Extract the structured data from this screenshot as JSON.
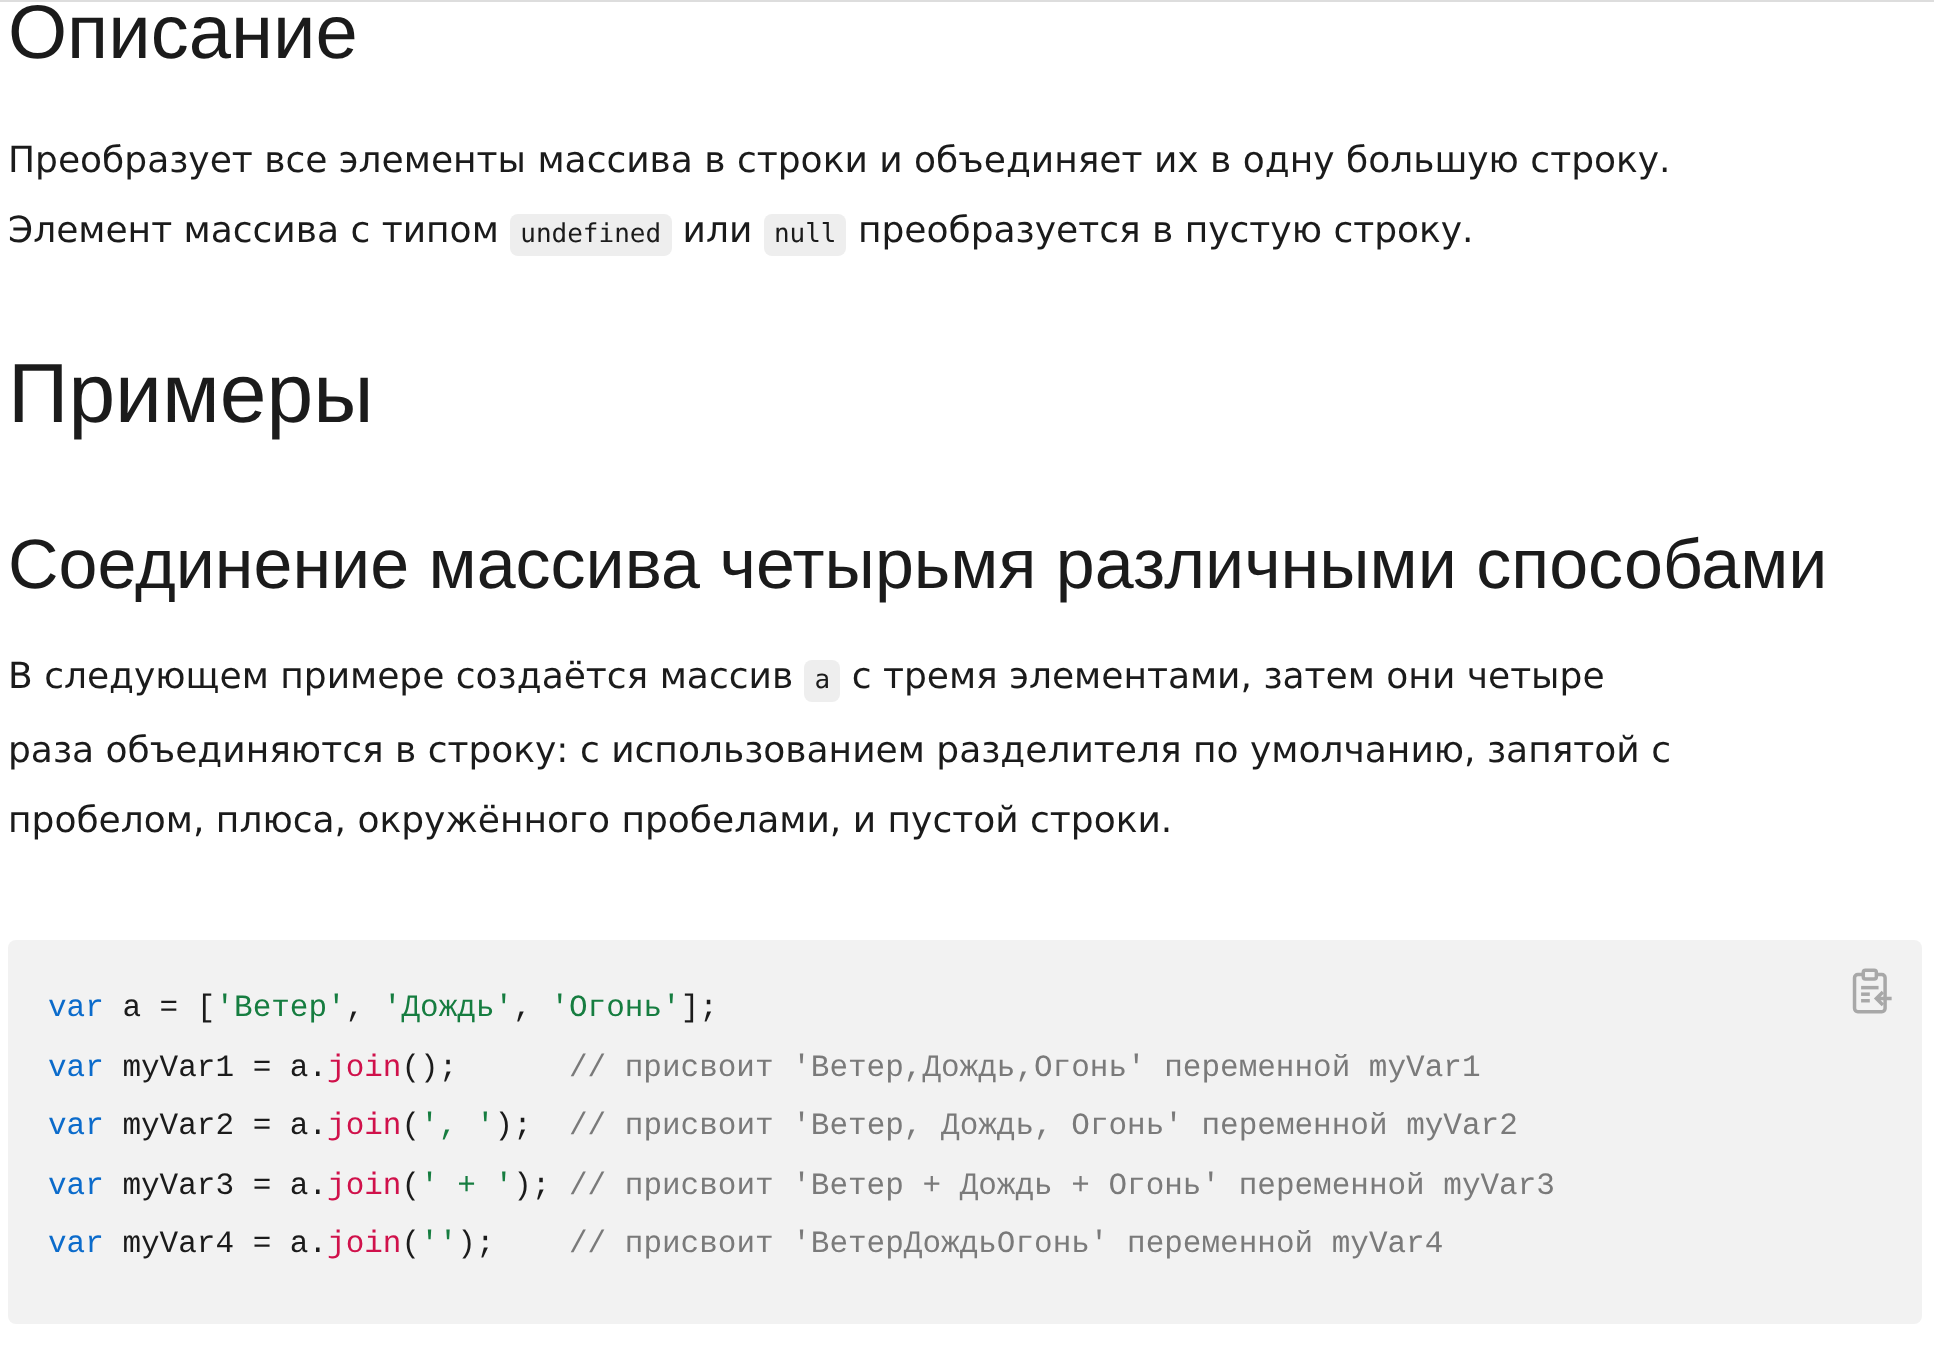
{
  "sections": [
    {
      "kind": "h2",
      "text": "Описание"
    },
    {
      "kind": "paragraph",
      "parts": [
        {
          "kind": "text",
          "text": "Преобразует все элементы массива в строки и объединяет их в одну большую строку. Элемент массива с типом "
        },
        {
          "kind": "code",
          "text": "undefined"
        },
        {
          "kind": "text",
          "text": " или "
        },
        {
          "kind": "code",
          "text": "null"
        },
        {
          "kind": "text",
          "text": " преобразуется в пустую строку."
        }
      ]
    },
    {
      "kind": "h2",
      "text": "Примеры"
    },
    {
      "kind": "h3",
      "text": "Соединение массива четырьмя различными способами"
    },
    {
      "kind": "paragraph",
      "parts": [
        {
          "kind": "text",
          "text": "В следующем примере создаётся массив "
        },
        {
          "kind": "code",
          "text": "a"
        },
        {
          "kind": "text",
          "text": " с тремя элементами, затем они четыре раза объединяются в строку: с использованием разделителя по умолчанию, запятой с пробелом, плюса, окружённого пробелами, и пустой строки."
        }
      ]
    },
    {
      "kind": "code_block",
      "lines": [
        [
          {
            "kind": "keyword",
            "text": "var"
          },
          {
            "kind": "plain",
            "text": " a = ["
          },
          {
            "kind": "string",
            "text": "'Ветер'"
          },
          {
            "kind": "plain",
            "text": ", "
          },
          {
            "kind": "string",
            "text": "'Дождь'"
          },
          {
            "kind": "plain",
            "text": ", "
          },
          {
            "kind": "string",
            "text": "'Огонь'"
          },
          {
            "kind": "plain",
            "text": "];"
          }
        ],
        [
          {
            "kind": "keyword",
            "text": "var"
          },
          {
            "kind": "plain",
            "text": " myVar1 = a."
          },
          {
            "kind": "function",
            "text": "join"
          },
          {
            "kind": "plain",
            "text": "();      "
          },
          {
            "kind": "comment",
            "text": "// присвоит 'Ветер,Дождь,Огонь' переменной myVar1"
          }
        ],
        [
          {
            "kind": "keyword",
            "text": "var"
          },
          {
            "kind": "plain",
            "text": " myVar2 = a."
          },
          {
            "kind": "function",
            "text": "join"
          },
          {
            "kind": "plain",
            "text": "("
          },
          {
            "kind": "string",
            "text": "', '"
          },
          {
            "kind": "plain",
            "text": ");  "
          },
          {
            "kind": "comment",
            "text": "// присвоит 'Ветер, Дождь, Огонь' переменной myVar2"
          }
        ],
        [
          {
            "kind": "keyword",
            "text": "var"
          },
          {
            "kind": "plain",
            "text": " myVar3 = a."
          },
          {
            "kind": "function",
            "text": "join"
          },
          {
            "kind": "plain",
            "text": "("
          },
          {
            "kind": "string",
            "text": "' + '"
          },
          {
            "kind": "plain",
            "text": "); "
          },
          {
            "kind": "comment",
            "text": "// присвоит 'Ветер + Дождь + Огонь' переменной myVar3"
          }
        ],
        [
          {
            "kind": "keyword",
            "text": "var"
          },
          {
            "kind": "plain",
            "text": " myVar4 = a."
          },
          {
            "kind": "function",
            "text": "join"
          },
          {
            "kind": "plain",
            "text": "("
          },
          {
            "kind": "string",
            "text": "''"
          },
          {
            "kind": "plain",
            "text": ");    "
          },
          {
            "kind": "comment",
            "text": "// присвоит 'ВетерДождьОгонь' переменной myVar4"
          }
        ]
      ]
    }
  ]
}
